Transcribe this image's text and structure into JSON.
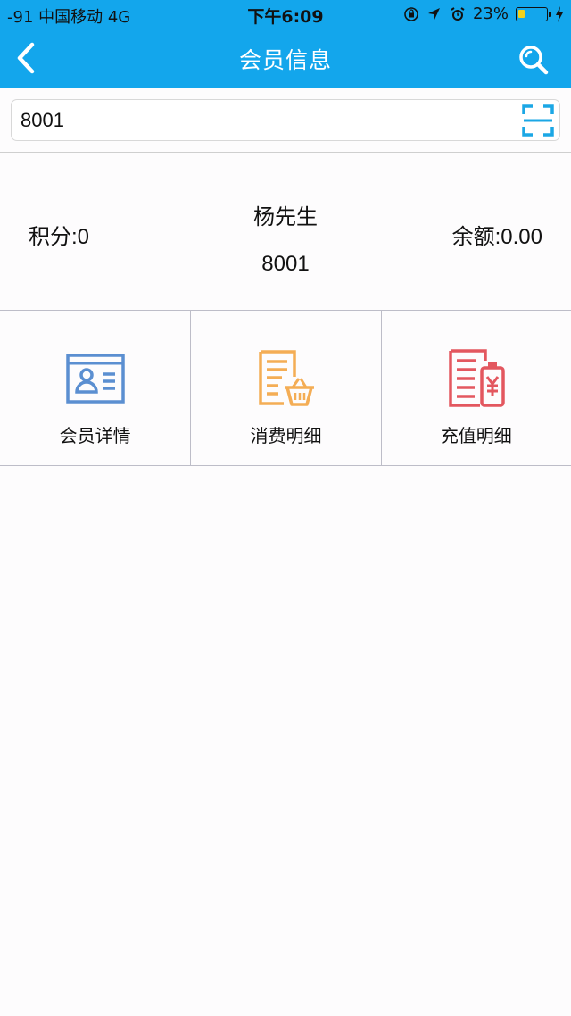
{
  "status_bar": {
    "carrier": "-91 中国移动   4G",
    "time": "下午6:09",
    "battery": "23%",
    "battery_level": 0.23
  },
  "nav": {
    "title": "会员信息",
    "back_icon": "chevron-left-icon",
    "search_icon": "search-icon"
  },
  "search": {
    "value": "8001",
    "scan_icon": "scan-icon"
  },
  "member": {
    "points": "积分:0",
    "name": "杨先生",
    "card_no": "8001",
    "balance": "余额:0.00"
  },
  "menu": {
    "items": [
      {
        "label": "会员详情",
        "icon": "member-card-icon",
        "color": "#5b8fd1"
      },
      {
        "label": "消费明细",
        "icon": "consumption-basket-icon",
        "color": "#f4ad55"
      },
      {
        "label": "充值明细",
        "icon": "recharge-yuan-icon",
        "color": "#e3575f"
      }
    ]
  },
  "colors": {
    "header": "#13a6ec",
    "scan": "#1ba7e5"
  }
}
